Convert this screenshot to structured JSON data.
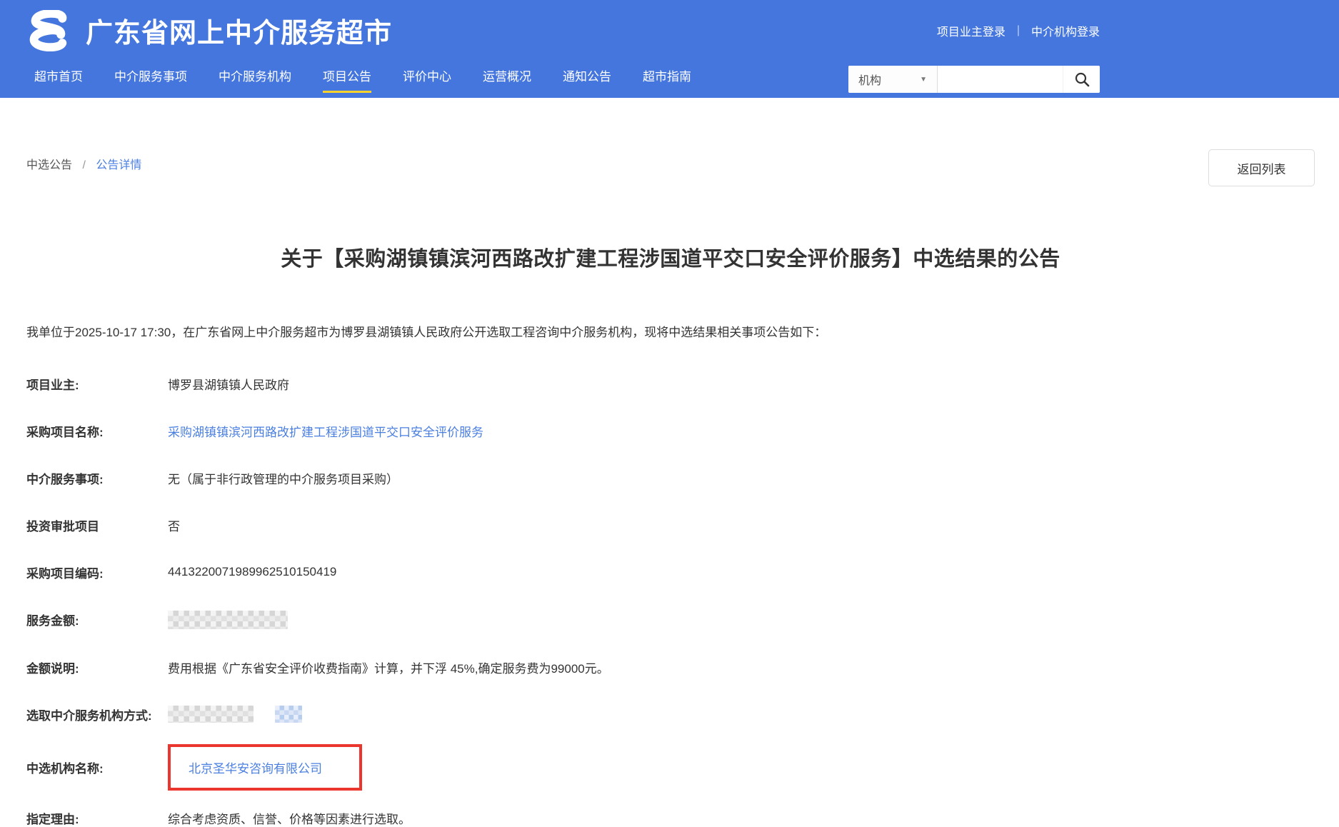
{
  "colors": {
    "header_blue": "#4476dd",
    "nav_active_underline": "#fdd22b",
    "link_blue": "#4a7fe0",
    "highlight_red": "#ea362c"
  },
  "header": {
    "site_title": "广东省网上中介服务超市",
    "logo_icon": "stylized-s-logo",
    "login_links": [
      {
        "label": "项目业主登录"
      },
      {
        "label": "中介机构登录"
      }
    ],
    "login_separator": "|",
    "nav": [
      {
        "label": "超市首页",
        "active": false
      },
      {
        "label": "中介服务事项",
        "active": false
      },
      {
        "label": "中介服务机构",
        "active": false
      },
      {
        "label": "项目公告",
        "active": true
      },
      {
        "label": "评价中心",
        "active": false
      },
      {
        "label": "运营概况",
        "active": false
      },
      {
        "label": "通知公告",
        "active": false
      },
      {
        "label": "超市指南",
        "active": false
      }
    ],
    "search": {
      "category_selected": "机构",
      "dropdown_arrow": "▼",
      "input_value": "",
      "button_icon": "search-magnifier"
    }
  },
  "breadcrumb": {
    "parent": "中选公告",
    "separator": "/",
    "current": "公告详情"
  },
  "back_button_label": "返回列表",
  "announcement": {
    "title": "关于【采购湖镇镇滨河西路改扩建工程涉国道平交口安全评价服务】中选结果的公告",
    "intro": "我单位于2025-10-17 17:30，在广东省网上中介服务超市为博罗县湖镇镇人民政府公开选取工程咨询中介服务机构，现将中选结果相关事项公告如下：",
    "fields": [
      {
        "label": "项目业主:",
        "value": "博罗县湖镇镇人民政府",
        "type": "text"
      },
      {
        "label": "采购项目名称:",
        "value": "采购湖镇镇滨河西路改扩建工程涉国道平交口安全评价服务",
        "type": "link"
      },
      {
        "label": "中介服务事项:",
        "value": "无（属于非行政管理的中介服务项目采购）",
        "type": "text"
      },
      {
        "label": "投资审批项目",
        "value": "否",
        "type": "text"
      },
      {
        "label": "采购项目编码:",
        "value": "4413220071989962510150419",
        "type": "text"
      },
      {
        "label": "服务金额:",
        "value": "",
        "type": "redacted"
      },
      {
        "label": "金额说明:",
        "value": "费用根据《广东省安全评价收费指南》计算，并下浮 45%,确定服务费为99000元。",
        "type": "text"
      },
      {
        "label": "选取中介服务机构方式:",
        "value": "",
        "type": "redacted"
      },
      {
        "label": "中选机构名称:",
        "value": "北京圣华安咨询有限公司",
        "type": "link-highlighted"
      },
      {
        "label": "指定理由:",
        "value": "综合考虑资质、信誉、价格等因素进行选取。",
        "type": "text"
      }
    ]
  }
}
